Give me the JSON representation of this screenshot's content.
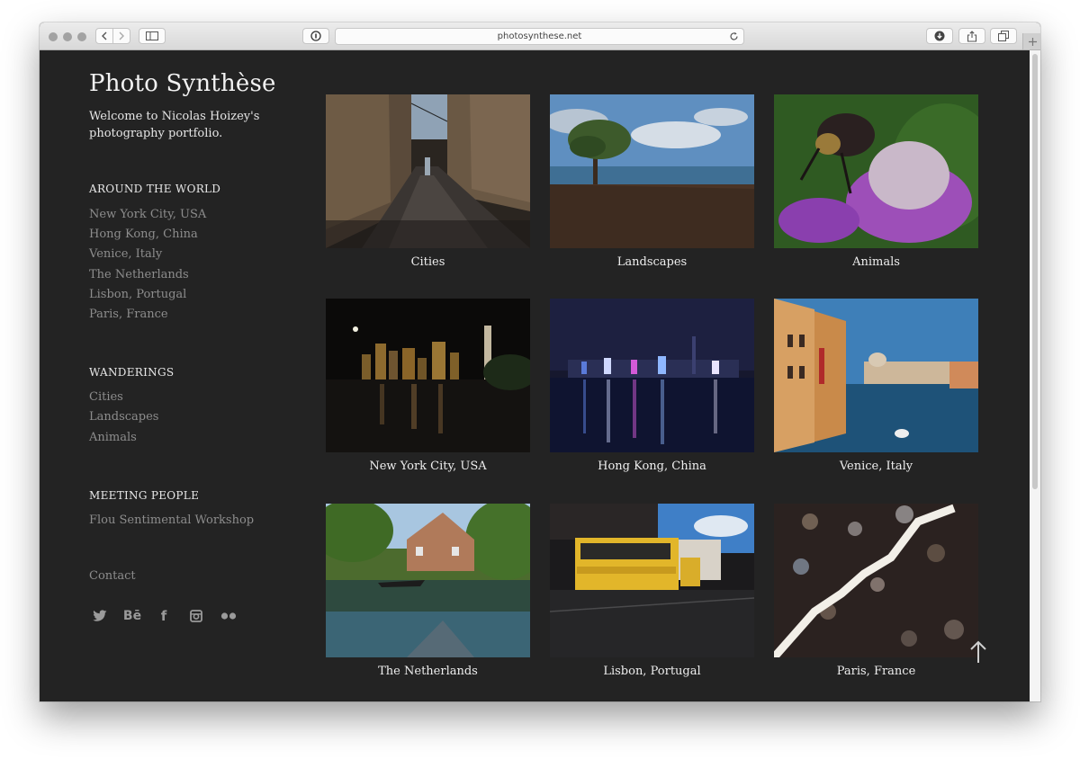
{
  "browser": {
    "url": "photosynthese.net"
  },
  "site": {
    "title": "Photo Synthèse",
    "tagline": "Welcome to Nicolas Hoizey's photography portfolio."
  },
  "sidebar": {
    "sections": [
      {
        "heading": "AROUND THE WORLD",
        "links": [
          "New York City, USA",
          "Hong Kong, China",
          "Venice, Italy",
          "The Netherlands",
          "Lisbon, Portugal",
          "Paris, France"
        ]
      },
      {
        "heading": "WANDERINGS",
        "links": [
          "Cities",
          "Landscapes",
          "Animals"
        ]
      },
      {
        "heading": "MEETING PEOPLE",
        "links": [
          "Flou Sentimental Workshop"
        ]
      }
    ],
    "contact": "Contact",
    "social": [
      {
        "name": "twitter-icon",
        "glyph": ""
      },
      {
        "name": "behance-icon",
        "glyph": "Bē"
      },
      {
        "name": "facebook-icon",
        "glyph": "f"
      },
      {
        "name": "instagram-icon",
        "glyph": ""
      },
      {
        "name": "flickr-icon",
        "glyph": ""
      }
    ]
  },
  "gallery": [
    {
      "caption": "Cities"
    },
    {
      "caption": "Landscapes"
    },
    {
      "caption": "Animals"
    },
    {
      "caption": "New York City, USA"
    },
    {
      "caption": "Hong Kong, China"
    },
    {
      "caption": "Venice, Italy"
    },
    {
      "caption": "The Netherlands"
    },
    {
      "caption": "Lisbon, Portugal"
    },
    {
      "caption": "Paris, France"
    }
  ],
  "colors": {
    "page_background": "#232323",
    "title_text": "#f2f2f2",
    "nav_link": "#8d8d8d"
  }
}
